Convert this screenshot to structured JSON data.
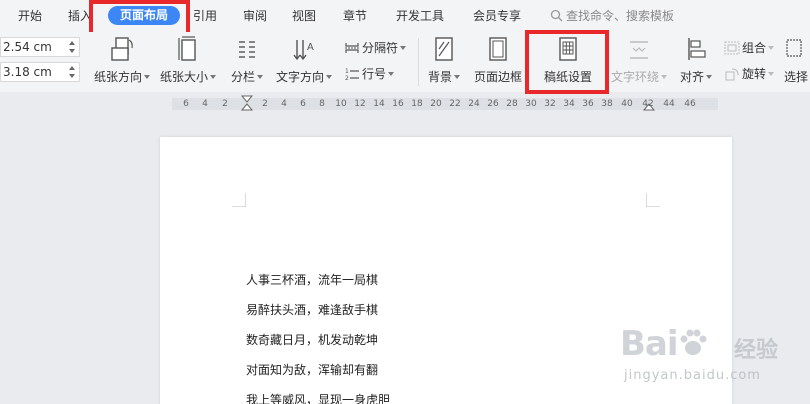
{
  "menu": {
    "tabs": [
      "开始",
      "插入",
      "页面布局",
      "引用",
      "审阅",
      "视图",
      "章节",
      "开发工具",
      "会员专享"
    ],
    "active_tab": "页面布局",
    "search_placeholder": "查找命令、搜索模板"
  },
  "ribbon": {
    "top_margin": "2.54 cm",
    "bottom_margin": "3.18 cm",
    "paper_direction": "纸张方向",
    "paper_size": "纸张大小",
    "columns": "分栏",
    "text_direction": "文字方向",
    "separator": "分隔符",
    "line_number": "行号",
    "background": "背景",
    "page_border": "页面边框",
    "manuscript_setup": "稿纸设置",
    "text_wrap": "文字环绕",
    "align": "对齐",
    "group": "组合",
    "rotate": "旋转",
    "select": "选择"
  },
  "ruler": {
    "labels": [
      "6",
      "4",
      "2",
      "2",
      "4",
      "6",
      "8",
      "10",
      "12",
      "14",
      "16",
      "18",
      "20",
      "22",
      "24",
      "26",
      "28",
      "30",
      "32",
      "34",
      "36",
      "38",
      "40",
      "42",
      "44",
      "46"
    ]
  },
  "document": {
    "lines": [
      "人事三杯酒，流年一局棋",
      "易醉扶头酒，难逢敌手棋",
      "数奇藏日月，机发动乾坤",
      "对面知为敌，浑输却有翻",
      "我上等威风，显现一身虎胆"
    ]
  },
  "watermark": {
    "logo": "Bai",
    "cn": "经验",
    "url": "jingyan.baidu.com"
  },
  "colors": {
    "active_tab": "#3d86f6",
    "highlight_box": "#e8282a",
    "ribbon_bg": "#f3f4f6",
    "workspace_bg": "#e9ebee"
  }
}
